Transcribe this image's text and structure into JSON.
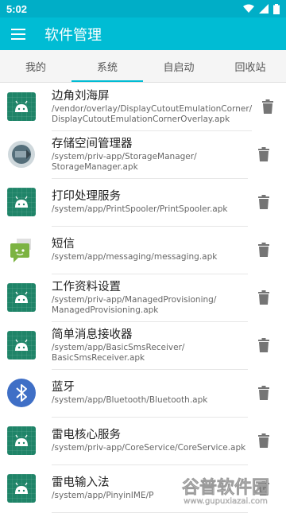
{
  "status": {
    "time": "5:02"
  },
  "appbar": {
    "title": "软件管理"
  },
  "tabs": [
    {
      "label": "我的",
      "active": false
    },
    {
      "label": "系统",
      "active": true
    },
    {
      "label": "自启动",
      "active": false
    },
    {
      "label": "回收站",
      "active": false
    }
  ],
  "apps": [
    {
      "name": "边角刘海屏",
      "path": "/vendor/overlay/DisplayCutoutEmulationCorner/\nDisplayCutoutEmulationCornerOverlay.apk",
      "icon": "android-icon"
    },
    {
      "name": "存储空间管理器",
      "path": "/system/priv-app/StorageManager/\nStorageManager.apk",
      "icon": "storage-icon"
    },
    {
      "name": "打印处理服务",
      "path": "/system/app/PrintSpooler/PrintSpooler.apk",
      "icon": "android-icon"
    },
    {
      "name": "短信",
      "path": "/system/app/messaging/messaging.apk",
      "icon": "messaging-icon"
    },
    {
      "name": "工作资料设置",
      "path": "/system/priv-app/ManagedProvisioning/\nManagedProvisioning.apk",
      "icon": "android-icon"
    },
    {
      "name": "简单消息接收器",
      "path": "/system/app/BasicSmsReceiver/\nBasicSmsReceiver.apk",
      "icon": "android-icon"
    },
    {
      "name": "蓝牙",
      "path": "/system/app/Bluetooth/Bluetooth.apk",
      "icon": "bluetooth-icon"
    },
    {
      "name": "雷电核心服务",
      "path": "/system/priv-app/CoreService/CoreService.apk",
      "icon": "android-icon"
    },
    {
      "name": "雷电输入法",
      "path": "/system/app/PinyinIME/P",
      "icon": "android-icon"
    }
  ],
  "watermark": {
    "line1": "谷普软件园",
    "line2": "www.gupuxiazai.com"
  },
  "colors": {
    "statusbar": "#00aec7",
    "appbar": "#00bcd4",
    "tab_indicator": "#00bcd4",
    "android_bg": "#1f8468"
  }
}
